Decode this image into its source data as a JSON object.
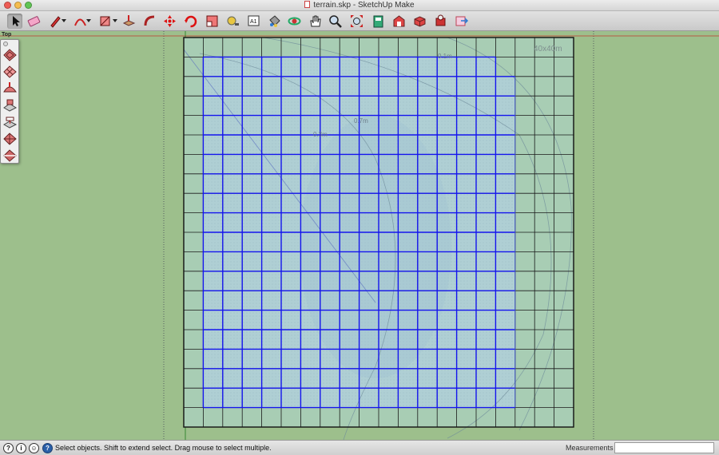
{
  "window": {
    "title": "terrain.skp - SketchUp Make"
  },
  "toolbar": {
    "tools": [
      {
        "name": "select-tool",
        "icon": "arrow-cursor-icon"
      },
      {
        "name": "eraser-tool",
        "icon": "eraser-icon"
      },
      {
        "name": "pencil-tool",
        "icon": "pencil-icon"
      },
      {
        "name": "arc-tool",
        "icon": "arc-icon"
      },
      {
        "name": "rectangle-tool",
        "icon": "rectangle-icon"
      },
      {
        "name": "push-pull-tool",
        "icon": "push-pull-icon"
      },
      {
        "name": "follow-me-tool",
        "icon": "follow-me-icon"
      },
      {
        "name": "move-tool",
        "icon": "move-arrows-icon"
      },
      {
        "name": "rotate-tool",
        "icon": "rotate-icon"
      },
      {
        "name": "scale-tool",
        "icon": "scale-icon"
      },
      {
        "name": "tape-measure-tool",
        "icon": "tape-measure-icon"
      },
      {
        "name": "text-tool",
        "icon": "text-icon"
      },
      {
        "name": "paint-bucket-tool",
        "icon": "paint-bucket-icon"
      },
      {
        "name": "orbit-tool",
        "icon": "orbit-icon"
      },
      {
        "name": "pan-tool",
        "icon": "hand-icon"
      },
      {
        "name": "zoom-tool",
        "icon": "magnifier-icon"
      },
      {
        "name": "zoom-extents-tool",
        "icon": "zoom-extents-icon"
      },
      {
        "name": "model-info-tool",
        "icon": "book-icon"
      },
      {
        "name": "warehouse-tool",
        "icon": "warehouse-icon"
      },
      {
        "name": "components-tool",
        "icon": "components-icon"
      },
      {
        "name": "extensions-tool",
        "icon": "extension-icon"
      },
      {
        "name": "send-tool",
        "icon": "send-to-layout-icon"
      }
    ]
  },
  "viewport": {
    "scene_label": "Top",
    "grid_label": "40x40m",
    "contour_labels": [
      "0.1m",
      "0.7m",
      "0.3m"
    ],
    "colors": {
      "background": "#9dbf8c",
      "terrain_fill": "#a8cdb4",
      "selected_fill": "#afcfd4",
      "grid_line": "#1a1a1a",
      "selected_edge": "#1414ee",
      "axis_red": "#c0392b",
      "axis_green": "#1e7a1e"
    }
  },
  "palette": {
    "tools": [
      {
        "name": "sandbox-from-contours",
        "icon": "contour-mesh-icon"
      },
      {
        "name": "sandbox-from-scratch",
        "icon": "grid-mesh-icon"
      },
      {
        "name": "smoove-tool",
        "icon": "smoove-icon"
      },
      {
        "name": "stamp-tool",
        "icon": "stamp-icon"
      },
      {
        "name": "drape-tool",
        "icon": "drape-icon"
      },
      {
        "name": "add-detail-tool",
        "icon": "add-detail-icon"
      },
      {
        "name": "flip-edge-tool",
        "icon": "flip-edge-icon"
      }
    ]
  },
  "statusbar": {
    "text": "Select objects. Shift to extend select. Drag mouse to select multiple.",
    "measurements_label": "Measurements",
    "measurements_value": ""
  }
}
